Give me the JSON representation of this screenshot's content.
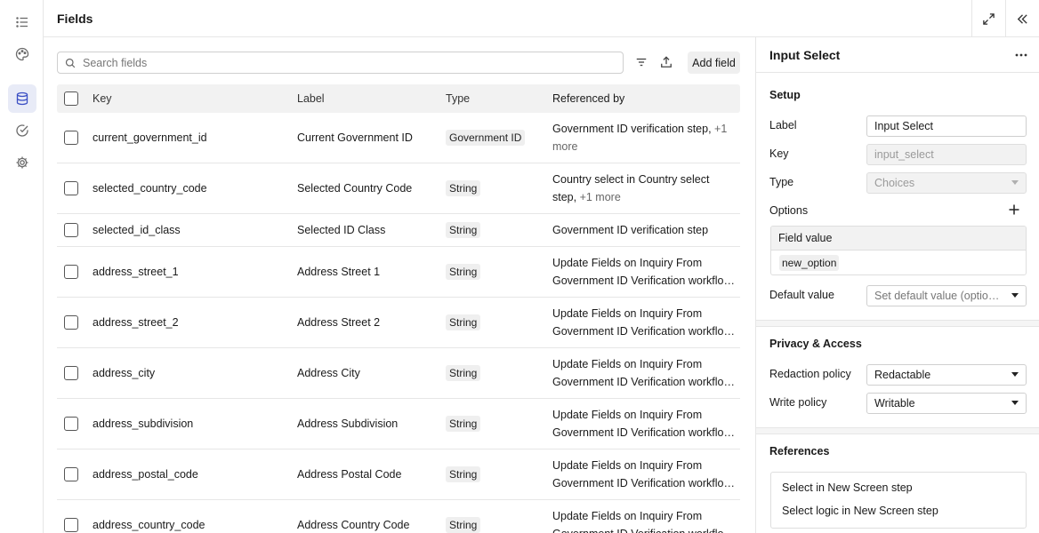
{
  "page": {
    "title": "Fields"
  },
  "rail": {
    "items": [
      {
        "icon": "list-icon"
      },
      {
        "icon": "palette-icon"
      },
      {
        "icon": "database-icon",
        "active": true
      },
      {
        "icon": "check-circle-icon"
      },
      {
        "icon": "gear-icon"
      }
    ]
  },
  "toolbar": {
    "search_placeholder": "Search fields",
    "add_field_label": "Add field"
  },
  "table": {
    "headers": {
      "key": "Key",
      "label": "Label",
      "type": "Type",
      "referenced_by": "Referenced by"
    },
    "rows": [
      {
        "key": "current_government_id",
        "label": "Current Government ID",
        "type": "Government ID",
        "ref": "Government ID verification step, ",
        "ref_more": "+1 more"
      },
      {
        "key": "selected_country_code",
        "label": "Selected Country Code",
        "type": "String",
        "ref": "Country select in Country select step, ",
        "ref_more": "+1 more"
      },
      {
        "key": "selected_id_class",
        "label": "Selected ID Class",
        "type": "String",
        "ref": "Government ID verification step",
        "ref_more": ""
      },
      {
        "key": "address_street_1",
        "label": "Address Street 1",
        "type": "String",
        "ref": "Update Fields on Inquiry From Government ID Verification workflow step",
        "ref_more": ""
      },
      {
        "key": "address_street_2",
        "label": "Address Street 2",
        "type": "String",
        "ref": "Update Fields on Inquiry From Government ID Verification workflow step",
        "ref_more": ""
      },
      {
        "key": "address_city",
        "label": "Address City",
        "type": "String",
        "ref": "Update Fields on Inquiry From Government ID Verification workflow step",
        "ref_more": ""
      },
      {
        "key": "address_subdivision",
        "label": "Address Subdivision",
        "type": "String",
        "ref": "Update Fields on Inquiry From Government ID Verification workflow step",
        "ref_more": ""
      },
      {
        "key": "address_postal_code",
        "label": "Address Postal Code",
        "type": "String",
        "ref": "Update Fields on Inquiry From Government ID Verification workflow step",
        "ref_more": ""
      },
      {
        "key": "address_country_code",
        "label": "Address Country Code",
        "type": "String",
        "ref": "Update Fields on Inquiry From Government ID Verification workflow step",
        "ref_more": ""
      }
    ]
  },
  "panel": {
    "title": "Input Select",
    "setup": {
      "title": "Setup",
      "label_label": "Label",
      "label_value": "Input Select",
      "key_label": "Key",
      "key_value": "input_select",
      "type_label": "Type",
      "type_value": "Choices",
      "options_label": "Options",
      "options_header": "Field value",
      "option_value": "new_option",
      "default_label": "Default value",
      "default_placeholder": "Set default value (optional)"
    },
    "privacy": {
      "title": "Privacy & Access",
      "redaction_label": "Redaction policy",
      "redaction_value": "Redactable",
      "write_label": "Write policy",
      "write_value": "Writable"
    },
    "references": {
      "title": "References",
      "items": [
        "Select in New Screen step",
        "Select logic in New Screen step"
      ]
    }
  }
}
